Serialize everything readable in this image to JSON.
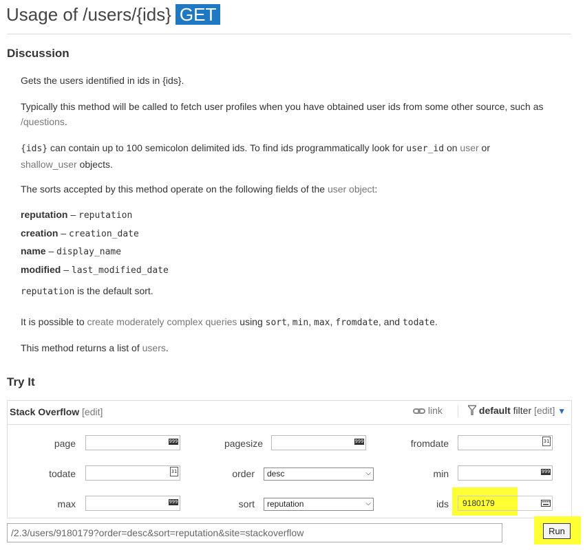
{
  "header": {
    "title": "Usage of /users/{ids}",
    "method": "GET"
  },
  "discussion": {
    "heading": "Discussion",
    "p1": "Gets the users identified in ids in {ids}.",
    "p2_text": "Typically this method will be called to fetch user profiles when you have obtained user ids from some other source, such as",
    "p2_link": "/questions",
    "p3_code": "{ids}",
    "p3_text": "can contain up to 100 semicolon delimited ids. To find ids programmatically look for",
    "p3_code2": "user_id",
    "p3_on": "on",
    "p3_link1": "user",
    "p3_or": "or",
    "p3_link2": "shallow_user",
    "p3_tail": "objects.",
    "p4_text": "The sorts accepted by this method operate on the following fields of the",
    "p4_link": "user object",
    "sorts": [
      {
        "name": "reputation",
        "field": "reputation"
      },
      {
        "name": "creation",
        "field": "creation_date"
      },
      {
        "name": "name",
        "field": "display_name"
      },
      {
        "name": "modified",
        "field": "last_modified_date"
      }
    ],
    "default_sort_code": "reputation",
    "default_sort_text": "is the default sort.",
    "p6_pre": "It is possible to",
    "p6_link": "create moderately complex queries",
    "p6_using": "using",
    "p6_codes": [
      "sort",
      "min",
      "max",
      "fromdate",
      "todate"
    ],
    "p6_and": "and",
    "p7_text": "This method returns a list of",
    "p7_link": "users"
  },
  "try_it": {
    "heading": "Try It",
    "site": "Stack Overflow",
    "edit": "[edit]",
    "link_label": "link",
    "filter_bold": "default",
    "filter_label": "filter",
    "filter_edit": "[edit]",
    "fields": {
      "page": {
        "label": "page",
        "value": ""
      },
      "pagesize": {
        "label": "pagesize",
        "value": ""
      },
      "fromdate": {
        "label": "fromdate",
        "value": ""
      },
      "todate": {
        "label": "todate",
        "value": ""
      },
      "order": {
        "label": "order",
        "value": "desc"
      },
      "min": {
        "label": "min",
        "value": ""
      },
      "max": {
        "label": "max",
        "value": ""
      },
      "sort": {
        "label": "sort",
        "value": "reputation"
      },
      "ids": {
        "label": "ids",
        "value": "9180179"
      }
    },
    "url": "/2.3/users/9180179?order=desc&sort=reputation&site=stackoverflow",
    "run_label": "Run"
  },
  "icons": {
    "number_spinner": "999",
    "calendar": "31"
  },
  "colors": {
    "get_badge": "#1f79c2",
    "highlight": "#ffff33",
    "link": "#777777"
  }
}
